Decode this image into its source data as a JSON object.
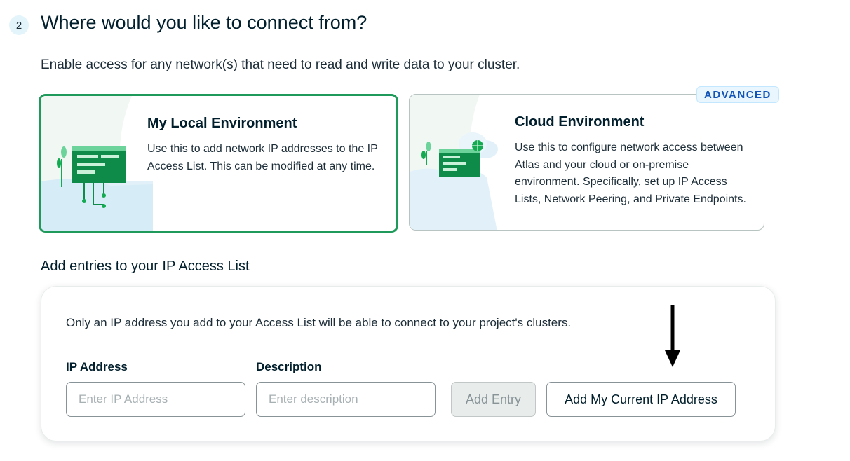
{
  "step": {
    "number": "2",
    "title": "Where would you like to connect from?",
    "subtitle": "Enable access for any network(s) that need to read and write data to your cluster."
  },
  "environments": {
    "local": {
      "title": "My Local Environment",
      "description": "Use this to add network IP addresses to the IP Access List. This can be modified at any time.",
      "selected": true
    },
    "cloud": {
      "badge": "ADVANCED",
      "title": "Cloud Environment",
      "description": "Use this to configure network access between Atlas and your cloud or on-premise environment. Specifically, set up IP Access Lists, Network Peering, and Private Endpoints.",
      "selected": false
    }
  },
  "access_list": {
    "section_title": "Add entries to your IP Access List",
    "note": "Only an IP address you add to your Access List will be able to connect to your project's clusters.",
    "ip_label": "IP Address",
    "ip_placeholder": "Enter IP Address",
    "ip_value": "",
    "desc_label": "Description",
    "desc_placeholder": "Enter description",
    "desc_value": "",
    "add_entry_label": "Add Entry",
    "add_current_ip_label": "Add My Current IP Address"
  },
  "icons": {
    "annotation": "down-arrow-icon",
    "local_illustration": "network-circuit-icon",
    "cloud_illustration": "cloud-network-icon"
  },
  "colors": {
    "selected_border": "#1f9a5b",
    "badge_text": "#1254b7",
    "badge_bg": "#e9f6fe",
    "illustration_green": "#13aa52"
  }
}
